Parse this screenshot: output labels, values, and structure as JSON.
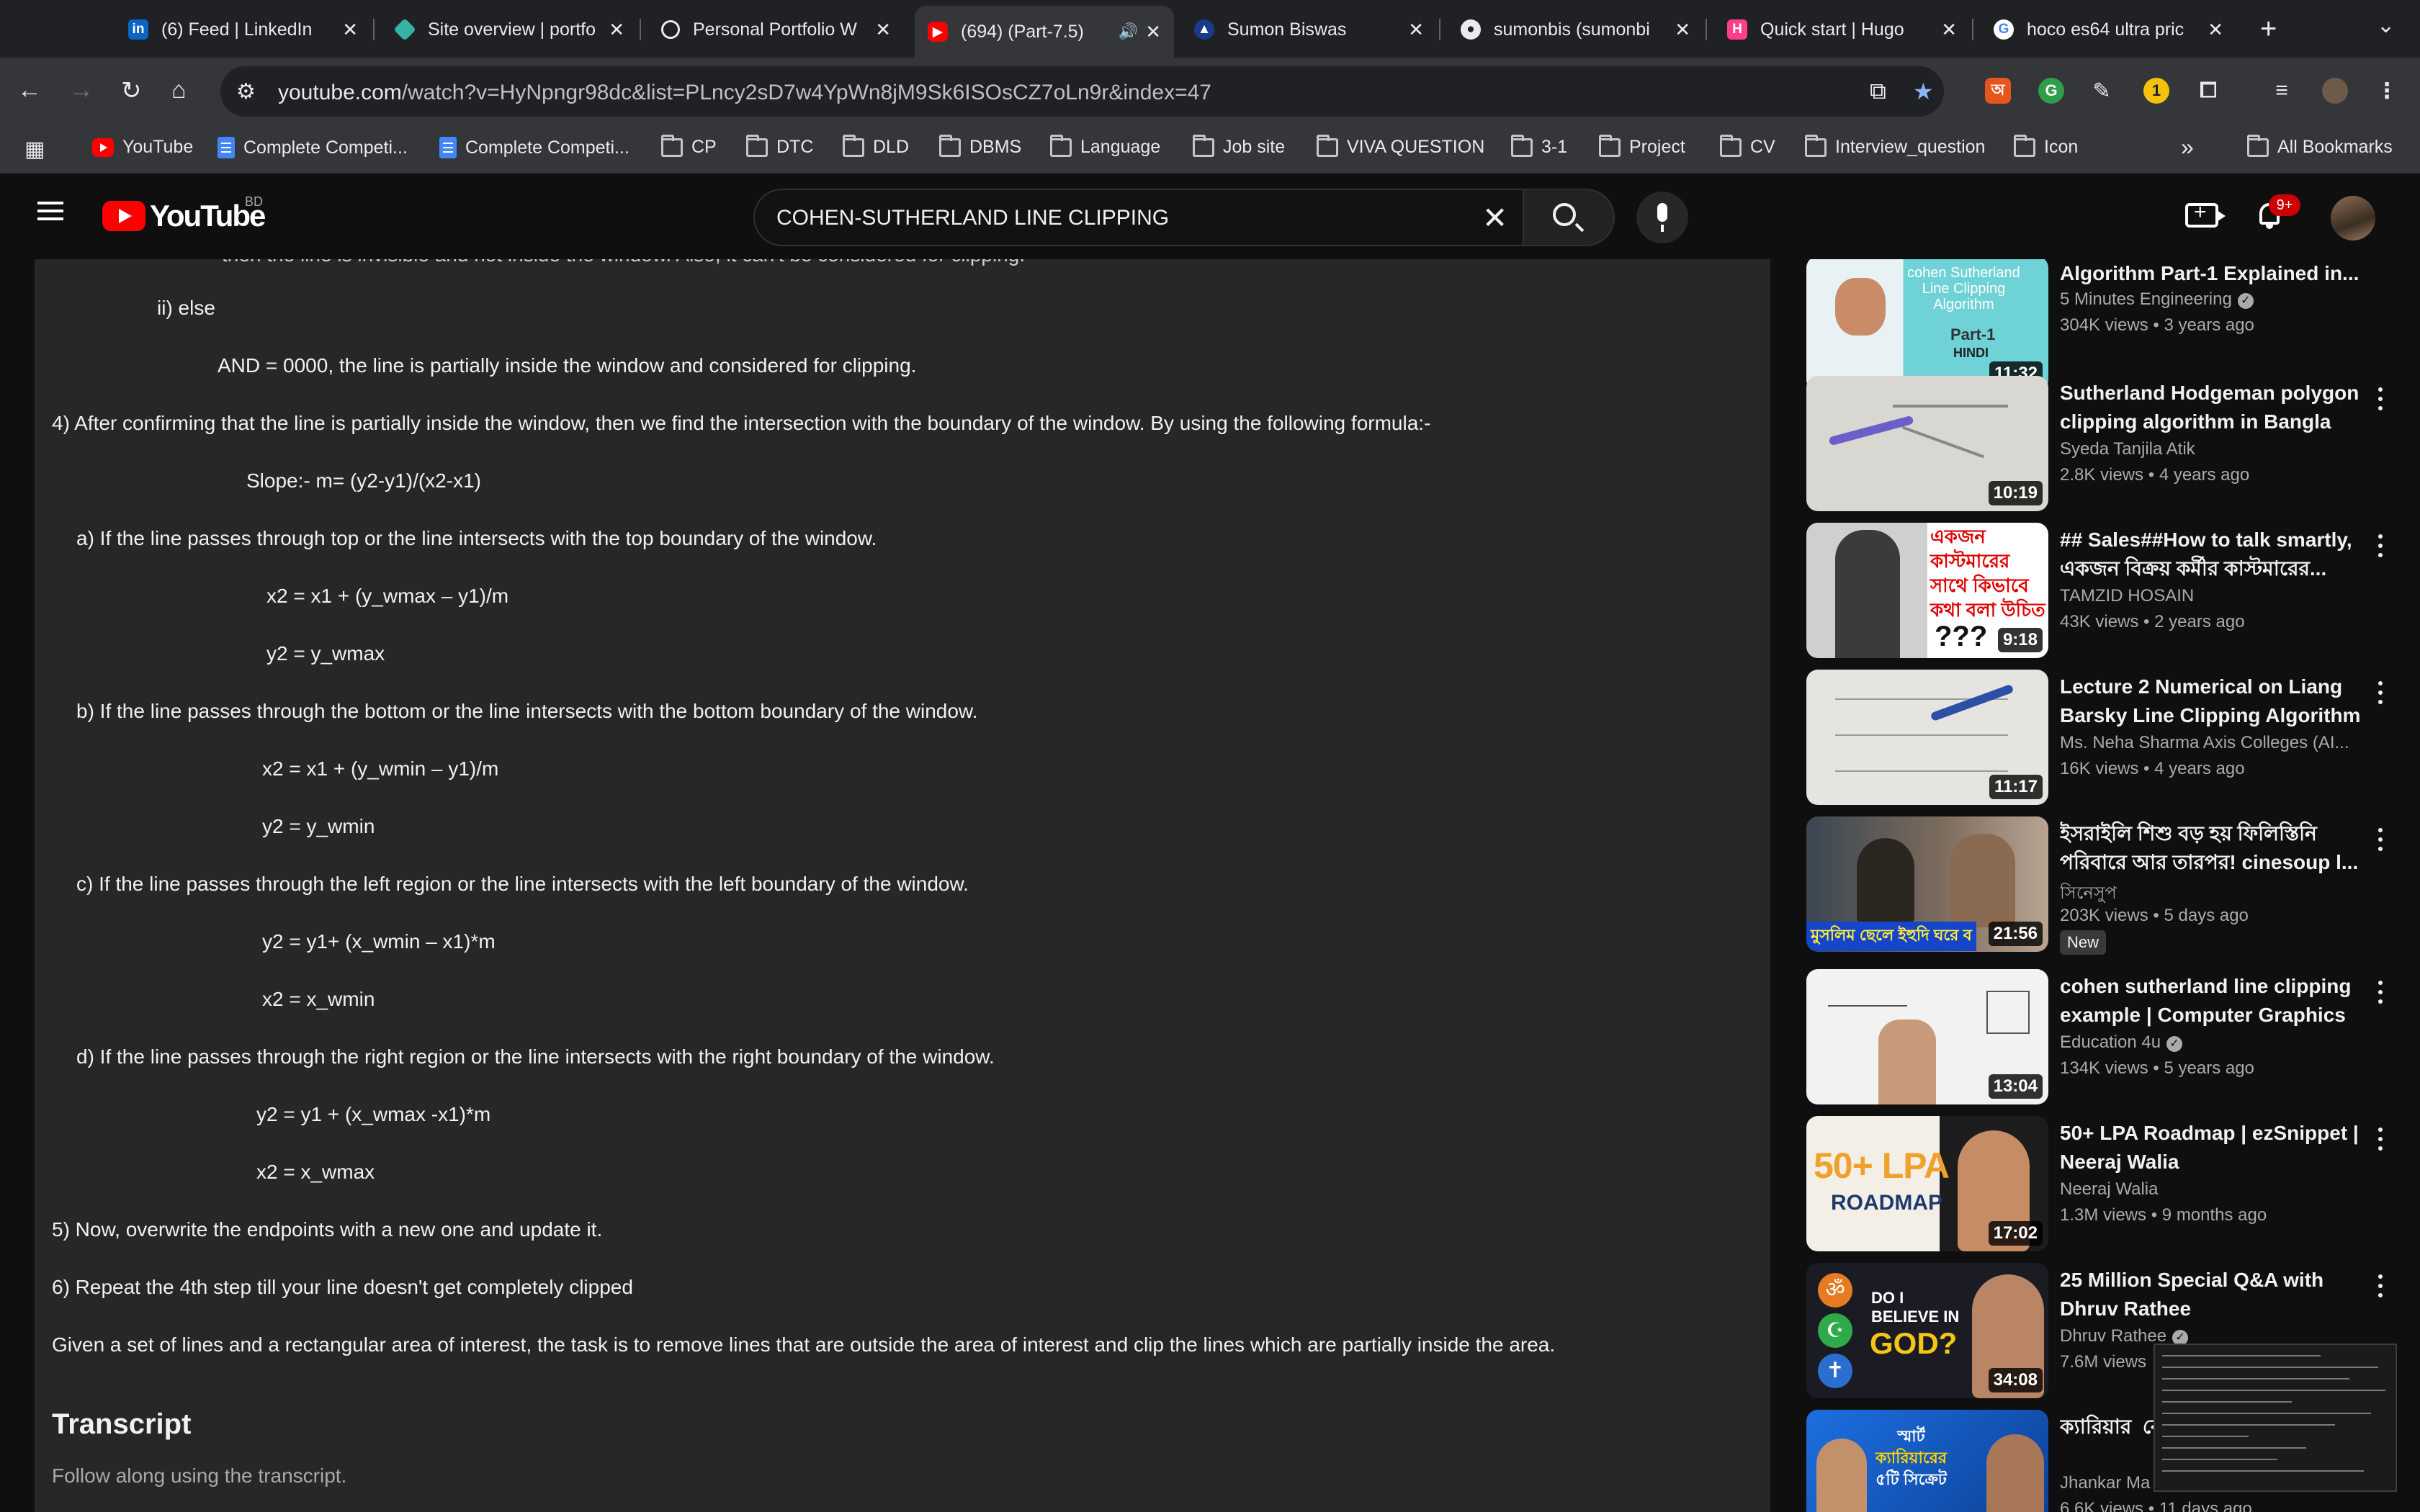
{
  "browser": {
    "tabs": [
      {
        "title": "(6) Feed | LinkedIn",
        "icon": "linkedin-icon"
      },
      {
        "title": "Site overview | portfo",
        "icon": "netlify-icon"
      },
      {
        "title": "Personal Portfolio W",
        "icon": "globe-icon"
      },
      {
        "title": "(694) (Part-7.5)",
        "icon": "youtube-icon",
        "active": true
      },
      {
        "title": "Sumon Biswas",
        "icon": "portfolio-icon"
      },
      {
        "title": "sumonbis (sumonbi",
        "icon": "github-icon"
      },
      {
        "title": "Quick start | Hugo",
        "icon": "hugo-icon"
      },
      {
        "title": "hoco es64 ultra pric",
        "icon": "google-icon"
      }
    ],
    "url_host": "youtube.com",
    "url_path": "/watch?v=HyNpngr98dc&list=PLncy2sD7w4YpWn8jM9Sk6ISOsCZ7oLn9r&index=47",
    "bookmarks": [
      {
        "label": "YouTube",
        "icon": "youtube-icon"
      },
      {
        "label": "Complete Competi...",
        "icon": "docs-icon"
      },
      {
        "label": "Complete Competi...",
        "icon": "docs-icon"
      },
      {
        "label": "CP",
        "icon": "folder-icon"
      },
      {
        "label": "DTC",
        "icon": "folder-icon"
      },
      {
        "label": "DLD",
        "icon": "folder-icon"
      },
      {
        "label": "DBMS",
        "icon": "folder-icon"
      },
      {
        "label": "Language",
        "icon": "folder-icon"
      },
      {
        "label": "Job site",
        "icon": "folder-icon"
      },
      {
        "label": "VIVA QUESTION",
        "icon": "folder-icon"
      },
      {
        "label": "3-1",
        "icon": "folder-icon"
      },
      {
        "label": "Project",
        "icon": "folder-icon"
      },
      {
        "label": "CV",
        "icon": "folder-icon"
      },
      {
        "label": "Interview_question",
        "icon": "folder-icon"
      },
      {
        "label": "Icon",
        "icon": "folder-icon"
      }
    ],
    "overflow": "»",
    "all_bookmarks": "All Bookmarks"
  },
  "youtube": {
    "logo_text": "YouTube",
    "country_code": "BD",
    "search_query": "COHEN-SUTHERLAND LINE CLIPPING",
    "notification_count": "9+"
  },
  "description": {
    "lines": [
      "then the line is invisible and not inside the window. Also, it can't be considered for clipping.",
      "ii) else",
      "AND = 0000, the line is partially inside the window and considered for clipping.",
      "4)  After confirming that the line is partially inside the window, then we find the intersection with the boundary of the window. By using the following formula:-",
      "Slope:- m= (y2-y1)/(x2-x1)",
      "a) If the line passes through top or the line intersects with the top boundary of the window.",
      "x2 = x1 + (y_wmax – y1)/m",
      "y2 = y_wmax",
      "b) If the line passes through the bottom or the line intersects with the bottom boundary of the window.",
      "x2 = x1 + (y_wmin – y1)/m",
      "y2 = y_wmin",
      "c) If the line passes through the left region or the line intersects with the left boundary of the window.",
      "y2 = y1+ (x_wmin – x1)*m",
      "x2 = x_wmin",
      "d) If the line passes through the right region or the line intersects with the right boundary of the window.",
      "y2 = y1 + (x_wmax -x1)*m",
      "x2 = x_wmax",
      "5) Now, overwrite the endpoints with a new one and update it.",
      "6) Repeat the 4th step till your line doesn't get completely clipped",
      "Given a set of lines and a rectangular area of interest, the task is to remove lines that are outside the area of interest and clip the lines which are partially inside the area."
    ],
    "transcript_title": "Transcript",
    "transcript_subtitle": "Follow along using the transcript."
  },
  "recommendations": [
    {
      "title": "Algorithm Part-1 Explained in...",
      "channel": "5 Minutes Engineering",
      "verified": true,
      "views": "304K views",
      "age": "3 years ago",
      "duration": "11:32"
    },
    {
      "title": "Sutherland Hodgeman polygon clipping algorithm in Bangla",
      "channel": "Syeda Tanjila Atik",
      "verified": false,
      "views": "2.8K views",
      "age": "4 years ago",
      "duration": "10:19"
    },
    {
      "title": "## Sales##How to talk smartly, একজন বিক্রয় কর্মীর কাস্টমারের...",
      "channel": "TAMZID HOSAIN",
      "verified": false,
      "views": "43K views",
      "age": "2 years ago",
      "duration": "9:18"
    },
    {
      "title": "Lecture 2 Numerical on Liang Barsky Line Clipping Algorithm",
      "channel": "Ms. Neha Sharma Axis Colleges (AI...",
      "verified": false,
      "views": "16K views",
      "age": "4 years ago",
      "duration": "11:17"
    },
    {
      "title": "ইসরাইলি শিশু বড় হয় ফিলিস্তিনি পরিবারে আর তারপর! cinesoup l...",
      "channel": "সিনেসুপ",
      "verified": false,
      "views": "203K views",
      "age": "5 days ago",
      "duration": "21:56",
      "badge": "New"
    },
    {
      "title": "cohen sutherland line clipping example | Computer Graphics |...",
      "channel": "Education 4u",
      "verified": true,
      "views": "134K views",
      "age": "5 years ago",
      "duration": "13:04"
    },
    {
      "title": "50+ LPA Roadmap | ezSnippet | Neeraj Walia",
      "channel": "Neeraj Walia",
      "verified": false,
      "views": "1.3M views",
      "age": "9 months ago",
      "duration": "17:02"
    },
    {
      "title": "25 Million Special Q&A with Dhruv Rathee",
      "channel": "Dhruv Rathee",
      "verified": true,
      "views": "7.6M views",
      "age": "",
      "duration": "34:08"
    },
    {
      "title": "ক্যারিয়ার ‍ বোঝলে লা",
      "channel": "Jhankar Ma",
      "verified": false,
      "views": "6.6K views",
      "age": "11 days ago",
      "duration": ""
    }
  ],
  "thumb_text": {
    "t1_lines": [
      "cohen Sutherland",
      "Line Clipping",
      "Algorithm",
      "Part-1",
      "HINDI"
    ],
    "t3_lines": [
      "একজন",
      "কাস্টমারের",
      "সাথে কিভাবে",
      "কথা বলা উচিত",
      "???"
    ],
    "t5_caption": "মুসলিম ছেলে ইহুদি ঘরে ব",
    "t7_big": "50+ LPA",
    "t7_small": "ROADMAP",
    "t8_lines": [
      "DO I",
      "BELIEVE IN",
      "GOD?"
    ],
    "t9_lines": [
      "স্মার্ট",
      "ক্যারিয়ারের",
      "৫টি সিক্রেট"
    ]
  },
  "colors": {
    "accent_red": "#ff0000",
    "badge_red": "#cc0000",
    "panel": "#272727",
    "page": "#0f0f0f"
  }
}
